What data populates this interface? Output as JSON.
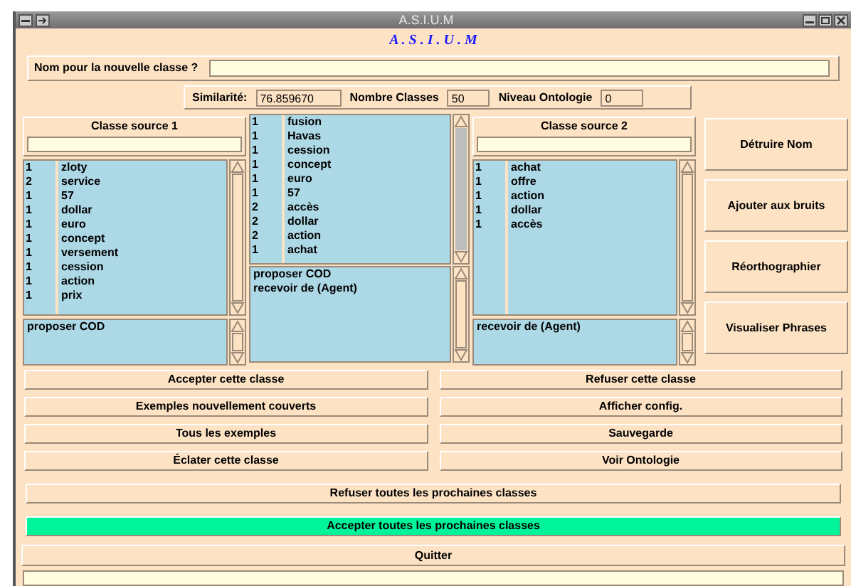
{
  "window": {
    "title": "A.S.I.U.M"
  },
  "heading": "A . S . I . U . M",
  "name_field": {
    "label": "Nom pour la nouvelle classe ?"
  },
  "metrics": [
    {
      "label": "Similarité:",
      "value": "76.859670"
    },
    {
      "label": "Nombre Classes",
      "value": "50"
    },
    {
      "label": "Niveau Ontologie",
      "value": "0"
    }
  ],
  "source_1": {
    "title": "Classe source 1",
    "rows": [
      {
        "count": "1",
        "word": "zloty"
      },
      {
        "count": "2",
        "word": "service"
      },
      {
        "count": "1",
        "word": "57"
      },
      {
        "count": "1",
        "word": "dollar"
      },
      {
        "count": "1",
        "word": "euro"
      },
      {
        "count": "1",
        "word": "concept"
      },
      {
        "count": "1",
        "word": "versement"
      },
      {
        "count": "1",
        "word": "cession"
      },
      {
        "count": "1",
        "word": "action"
      },
      {
        "count": "1",
        "word": "prix"
      }
    ],
    "verbs": [
      "proposer COD"
    ]
  },
  "merged": {
    "rows": [
      {
        "count": "1",
        "word": "fusion"
      },
      {
        "count": "1",
        "word": "Havas"
      },
      {
        "count": "1",
        "word": "cession"
      },
      {
        "count": "1",
        "word": "concept"
      },
      {
        "count": "1",
        "word": "euro"
      },
      {
        "count": "1",
        "word": "57"
      },
      {
        "count": "2",
        "word": "accès"
      },
      {
        "count": "2",
        "word": "dollar"
      },
      {
        "count": "2",
        "word": "action"
      },
      {
        "count": "1",
        "word": "achat"
      }
    ],
    "verbs": [
      "proposer COD",
      "recevoir de (Agent)"
    ]
  },
  "source_2": {
    "title": "Classe source 2",
    "rows": [
      {
        "count": "1",
        "word": "achat"
      },
      {
        "count": "1",
        "word": "offre"
      },
      {
        "count": "1",
        "word": "action"
      },
      {
        "count": "1",
        "word": "dollar"
      },
      {
        "count": "1",
        "word": "accès"
      }
    ],
    "verbs": [
      "recevoir de (Agent)"
    ]
  },
  "side_buttons": [
    "Détruire Nom",
    "Ajouter aux bruits",
    "Réorthographier",
    "Visualiser Phrases"
  ],
  "buttons": [
    "Accepter cette classe",
    "Refuser cette classe",
    "Exemples nouvellement couverts",
    "Afficher config.",
    "Tous les exemples",
    "Sauvegarde",
    "Éclater cette classe",
    "Voir Ontologie"
  ],
  "wide_buttons": [
    {
      "label": "Refuser toutes les prochaines classes",
      "highlighted": false
    },
    {
      "label": "Accepter toutes les prochaines classes",
      "highlighted": true
    }
  ],
  "quit_button": "Quitter"
}
